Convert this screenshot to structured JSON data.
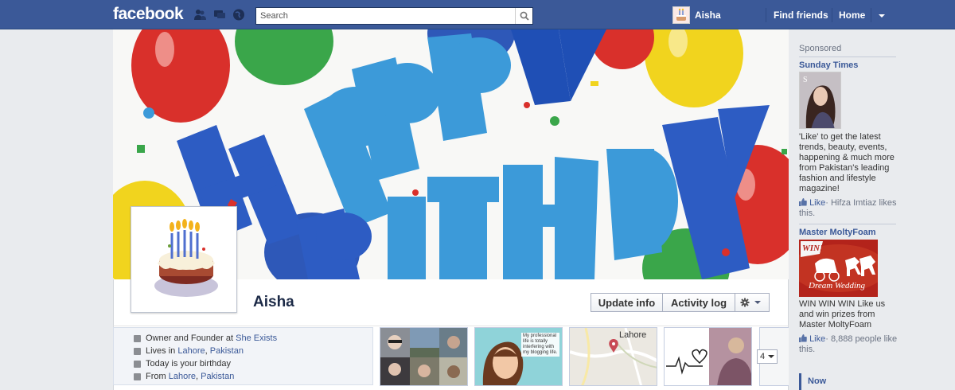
{
  "header": {
    "logo": "facebook",
    "search_placeholder": "Search",
    "user_name": "Aisha",
    "nav_find_friends": "Find friends",
    "nav_home": "Home"
  },
  "profile": {
    "name": "Aisha",
    "update_info_label": "Update info",
    "activity_log_label": "Activity log"
  },
  "about": {
    "work_prefix": "Owner and Founder at ",
    "work_place": "She Exists",
    "lives_prefix": "Lives in ",
    "lives_city": "Lahore",
    "lives_country": "Pakistan",
    "birthday": "Today is your birthday",
    "from_prefix": "From ",
    "from_city": "Lahore",
    "from_country": "Pakistan"
  },
  "tiles": {
    "notes_text": "My professional life is totally interfering with my blogging life.",
    "map_label": "Lahore",
    "more_count": "4"
  },
  "sidebar": {
    "sponsored": "Sponsored",
    "ad1_title": "Sunday Times",
    "ad1_text": "'Like' to get the latest trends, beauty, events, happening & much more from Pakistan's leading fashion and lifestyle magazine!",
    "ad1_like_action": "Like",
    "ad1_like_text": "· Hifza Imtiaz likes this.",
    "ad2_title": "Master MoltyFoam",
    "ad2_image_text_1": "WIN!",
    "ad2_image_text_2": "Dream Wedding",
    "ad2_text": "WIN WIN WIN Like us and win prizes from Master MoltyFoam",
    "ad2_like_action": "Like",
    "ad2_like_text": "· 8,888 people like this.",
    "now_label": "Now"
  },
  "colors": {
    "brand_blue": "#3b5998",
    "link_blue": "#3b5998",
    "page_bg": "#e9ebee"
  },
  "icons": [
    "friends-icon",
    "messages-icon",
    "notifications-globe-icon",
    "search-icon",
    "settings-gear-icon",
    "dropdown-arrow-icon",
    "like-thumb-icon"
  ]
}
